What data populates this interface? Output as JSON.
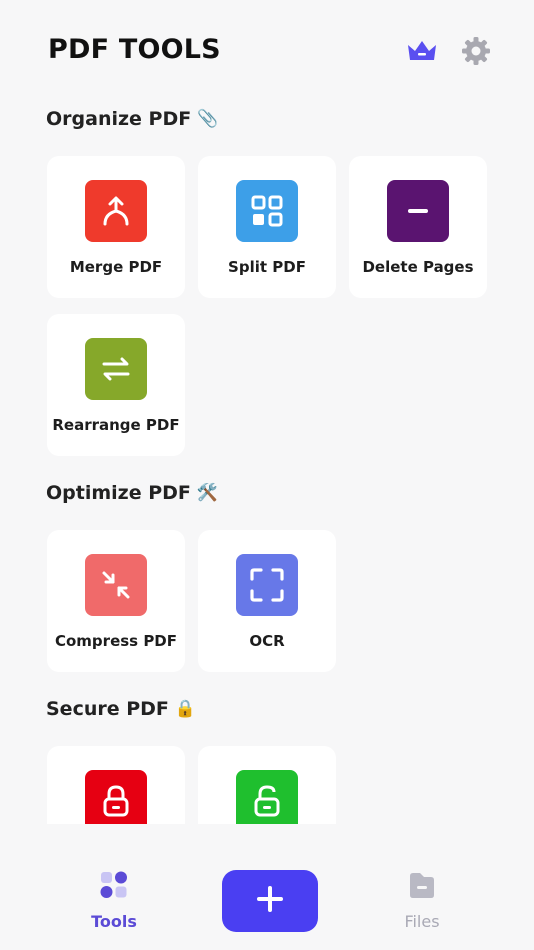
{
  "header": {
    "title": "PDF TOOLS",
    "premium_icon": "crown-icon",
    "settings_icon": "gear-icon",
    "accent": "#5a4ff0"
  },
  "sections": [
    {
      "title": "Organize PDF",
      "emoji": "📎",
      "tools": [
        {
          "label": "Merge PDF",
          "icon": "merge-icon",
          "color": "#ef3a2c"
        },
        {
          "label": "Split PDF",
          "icon": "grid-icon",
          "color": "#3d9fe8"
        },
        {
          "label": "Delete Pages",
          "icon": "minus-icon",
          "color": "#5a1470"
        },
        {
          "label": "Rearrange PDF",
          "icon": "swap-icon",
          "color": "#86a82a"
        }
      ]
    },
    {
      "title": "Optimize PDF",
      "emoji": "🛠️",
      "tools": [
        {
          "label": "Compress PDF",
          "icon": "compress-icon",
          "color": "#f06a6a"
        },
        {
          "label": "OCR",
          "icon": "scan-icon",
          "color": "#6778e8"
        }
      ]
    },
    {
      "title": "Secure PDF",
      "emoji": "🔒",
      "tools": [
        {
          "label": "",
          "icon": "lock-icon",
          "color": "#e60012"
        },
        {
          "label": "",
          "icon": "unlock-icon",
          "color": "#1fbf2e"
        }
      ]
    }
  ],
  "bottom_nav": {
    "tools_label": "Tools",
    "files_label": "Files",
    "add_icon": "plus-icon",
    "active_color": "#5b4bd6",
    "fab_color": "#4a3ff2"
  }
}
